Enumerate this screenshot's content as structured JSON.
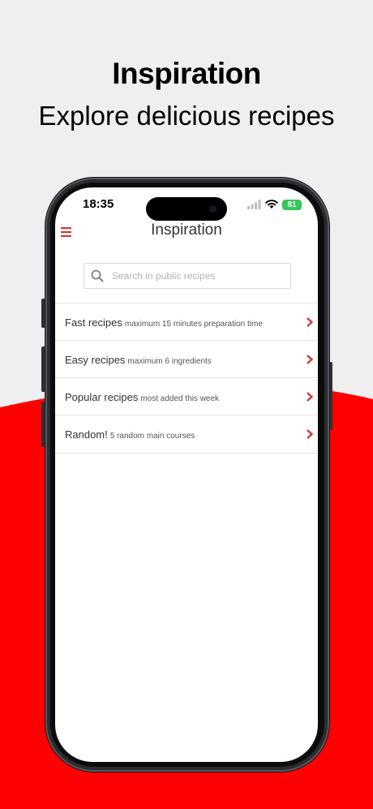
{
  "page": {
    "title": "Inspiration",
    "subtitle": "Explore delicious recipes"
  },
  "colors": {
    "accent": "#ff0000",
    "icon_red": "#d03a3a",
    "background": "#efefef"
  },
  "status_bar": {
    "time": "18:35",
    "battery": "81"
  },
  "app": {
    "nav_title": "Inspiration",
    "menu_icon": "hamburger-icon",
    "search": {
      "placeholder": "Search in public recipes",
      "value": ""
    },
    "items": [
      {
        "label": "Fast recipes",
        "desc": "maximum 15 minutes preparation time"
      },
      {
        "label": "Easy recipes",
        "desc": "maximum 6 ingredients"
      },
      {
        "label": "Popular recipes",
        "desc": "most added this week"
      },
      {
        "label": "Random!",
        "desc": "5 random main courses"
      }
    ]
  }
}
